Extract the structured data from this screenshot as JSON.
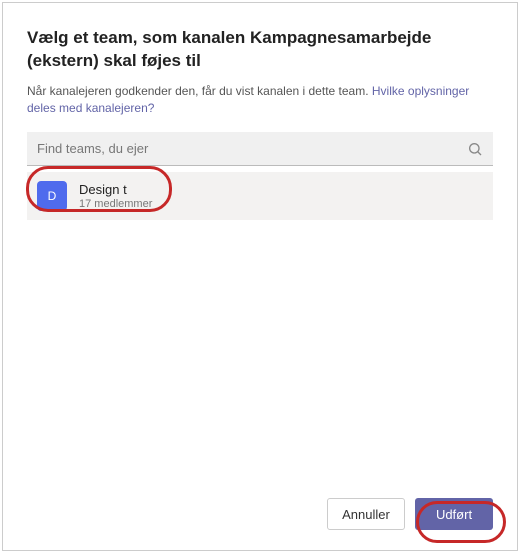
{
  "dialog": {
    "title": "Vælg et team, som kanalen Kampagnesamarbejde (ekstern) skal føjes til",
    "subtitle_prefix": "Når kanalejeren godkender den, får du vist kanalen i dette team. ",
    "subtitle_link": "Hvilke oplysninger deles med kanalejeren?"
  },
  "search": {
    "placeholder": "Find teams, du ejer"
  },
  "teams": [
    {
      "initial": "D",
      "name": "Design t",
      "members": "17 medlemmer"
    }
  ],
  "footer": {
    "cancel": "Annuller",
    "done": "Udført"
  },
  "colors": {
    "primary": "#6264a7",
    "avatar": "#4f6bed",
    "highlight": "#c62828"
  }
}
